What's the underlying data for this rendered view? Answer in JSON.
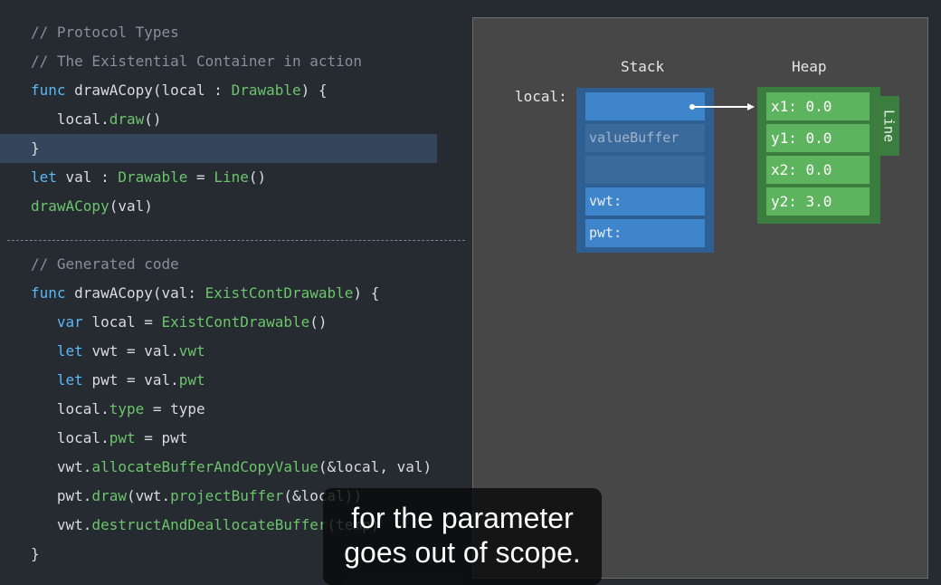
{
  "code": {
    "top": [
      [
        {
          "t": "// Protocol Types",
          "c": "com"
        }
      ],
      [
        {
          "t": "// The Existential Container in action",
          "c": "com"
        }
      ],
      [
        {
          "t": "func",
          "c": "kw"
        },
        {
          "t": " drawACopy(local : ",
          "c": "pl"
        },
        {
          "t": "Drawable",
          "c": "ty"
        },
        {
          "t": ") {",
          "c": "pl"
        }
      ],
      [
        {
          "t": "   local.",
          "c": "pl"
        },
        {
          "t": "draw",
          "c": "ty"
        },
        {
          "t": "()",
          "c": "pl"
        }
      ],
      [
        {
          "t": "}",
          "c": "pl"
        }
      ],
      [
        {
          "t": "let",
          "c": "kw"
        },
        {
          "t": " val : ",
          "c": "pl"
        },
        {
          "t": "Drawable",
          "c": "ty"
        },
        {
          "t": " = ",
          "c": "pl"
        },
        {
          "t": "Line",
          "c": "ty"
        },
        {
          "t": "()",
          "c": "pl"
        }
      ],
      [
        {
          "t": "drawACopy",
          "c": "ty"
        },
        {
          "t": "(val)",
          "c": "pl"
        }
      ]
    ],
    "bottom": [
      [
        {
          "t": "// Generated code",
          "c": "com"
        }
      ],
      [
        {
          "t": "func",
          "c": "kw"
        },
        {
          "t": " drawACopy(val: ",
          "c": "pl"
        },
        {
          "t": "ExistContDrawable",
          "c": "ty"
        },
        {
          "t": ") {",
          "c": "pl"
        }
      ],
      [
        {
          "t": "   ",
          "c": "pl"
        },
        {
          "t": "var",
          "c": "kw"
        },
        {
          "t": " local = ",
          "c": "pl"
        },
        {
          "t": "ExistContDrawable",
          "c": "ty"
        },
        {
          "t": "()",
          "c": "pl"
        }
      ],
      [
        {
          "t": "   ",
          "c": "pl"
        },
        {
          "t": "let",
          "c": "kw"
        },
        {
          "t": " vwt = val.",
          "c": "pl"
        },
        {
          "t": "vwt",
          "c": "ty"
        }
      ],
      [
        {
          "t": "   ",
          "c": "pl"
        },
        {
          "t": "let",
          "c": "kw"
        },
        {
          "t": " pwt = val.",
          "c": "pl"
        },
        {
          "t": "pwt",
          "c": "ty"
        }
      ],
      [
        {
          "t": "   local.",
          "c": "pl"
        },
        {
          "t": "type",
          "c": "ty"
        },
        {
          "t": " = type",
          "c": "pl"
        }
      ],
      [
        {
          "t": "   local.",
          "c": "pl"
        },
        {
          "t": "pwt",
          "c": "ty"
        },
        {
          "t": " = pwt",
          "c": "pl"
        }
      ],
      [
        {
          "t": "   vwt.",
          "c": "pl"
        },
        {
          "t": "allocateBufferAndCopyValue",
          "c": "ty"
        },
        {
          "t": "(&local, val)",
          "c": "pl"
        }
      ],
      [
        {
          "t": "   pwt.",
          "c": "pl"
        },
        {
          "t": "draw",
          "c": "ty"
        },
        {
          "t": "(vwt.",
          "c": "pl"
        },
        {
          "t": "projectBuffer",
          "c": "ty"
        },
        {
          "t": "(&local))",
          "c": "pl"
        }
      ],
      [
        {
          "t": "   vwt.",
          "c": "pl"
        },
        {
          "t": "destructAndDeallocateBuffer",
          "c": "ty"
        },
        {
          "t": "(temp)",
          "c": "pl"
        }
      ],
      [
        {
          "t": "}",
          "c": "pl"
        }
      ]
    ],
    "highlighted_top_line": 4
  },
  "diagram": {
    "stack_title": "Stack",
    "heap_title": "Heap",
    "local_label": "local:",
    "stack_cells": [
      "",
      "valueBuffer",
      "",
      "vwt:",
      "pwt:"
    ],
    "heap_cells": [
      "x1: 0.0",
      "y1: 0.0",
      "x2: 0.0",
      "y2: 3.0"
    ],
    "heap_type_label": "Line"
  },
  "caption": {
    "line1": "for the parameter",
    "line2": "goes out of scope."
  },
  "colors": {
    "background": "#262a31",
    "comment": "#8a8f99",
    "keyword": "#5bb8f5",
    "type": "#6cc56c",
    "line_highlight": "#34465c",
    "stack_cell": "#3f85cb",
    "heap_cell": "#5eb35e"
  }
}
